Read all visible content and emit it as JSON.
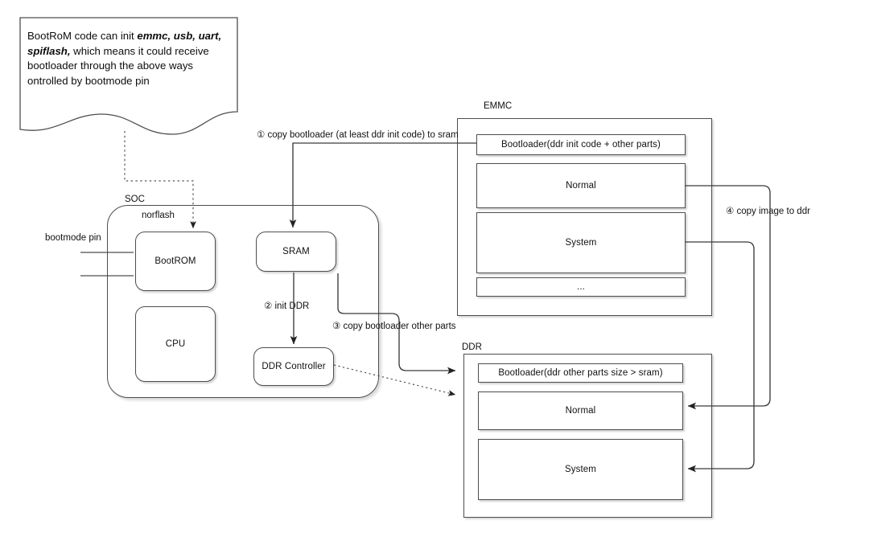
{
  "diagram": {
    "title_note": {
      "name": "bootrom-note",
      "text_parts": [
        {
          "text": "BootRoM code can init ",
          "emphasis": false
        },
        {
          "text": "emmc, usb, uart, spiflash,",
          "emphasis": true
        },
        {
          "text": " which means it could receive bootloader through the above ways ontrolled by bootmode pin",
          "emphasis": false
        }
      ],
      "plain_text": "BootRoM code can init emmc, usb, uart, spiflash, which means it could receive bootloader through the above ways ontrolled by bootmode pin"
    },
    "labels": {
      "soc": "SOC",
      "norflash": "norflash",
      "bootmode_pin": "bootmode pin",
      "emmc": "EMMC",
      "ddr": "DDR"
    },
    "soc_blocks": [
      {
        "id": "bootrom",
        "label": "BootROM"
      },
      {
        "id": "cpu",
        "label": "CPU"
      },
      {
        "id": "sram",
        "label": "SRAM"
      },
      {
        "id": "ddr-controller",
        "label": "DDR Controller"
      }
    ],
    "emmc_partitions": [
      {
        "id": "emmc-bootloader",
        "label": "Bootloader(ddr init code + other parts)"
      },
      {
        "id": "emmc-normal",
        "label": "Normal"
      },
      {
        "id": "emmc-system",
        "label": "System"
      },
      {
        "id": "emmc-ellipsis",
        "label": "..."
      }
    ],
    "ddr_partitions": [
      {
        "id": "ddr-bootloader",
        "label": "Bootloader(ddr other parts size > sram)"
      },
      {
        "id": "ddr-normal",
        "label": "Normal"
      },
      {
        "id": "ddr-system",
        "label": "System"
      }
    ],
    "steps": [
      {
        "n": "①",
        "id": "step-1",
        "label": "① copy bootloader (at least ddr init code) to sram"
      },
      {
        "n": "②",
        "id": "step-2",
        "label": "② init DDR"
      },
      {
        "n": "③",
        "id": "step-3",
        "label": "③ copy bootloader other parts"
      },
      {
        "n": "④",
        "id": "step-4",
        "label": "④ copy image to ddr"
      }
    ],
    "colors": {
      "stroke": "#4d4d4d",
      "text": "#111111",
      "background": "#ffffff",
      "dotted_stroke": "#555555",
      "arrow_stroke": "#333333"
    }
  }
}
